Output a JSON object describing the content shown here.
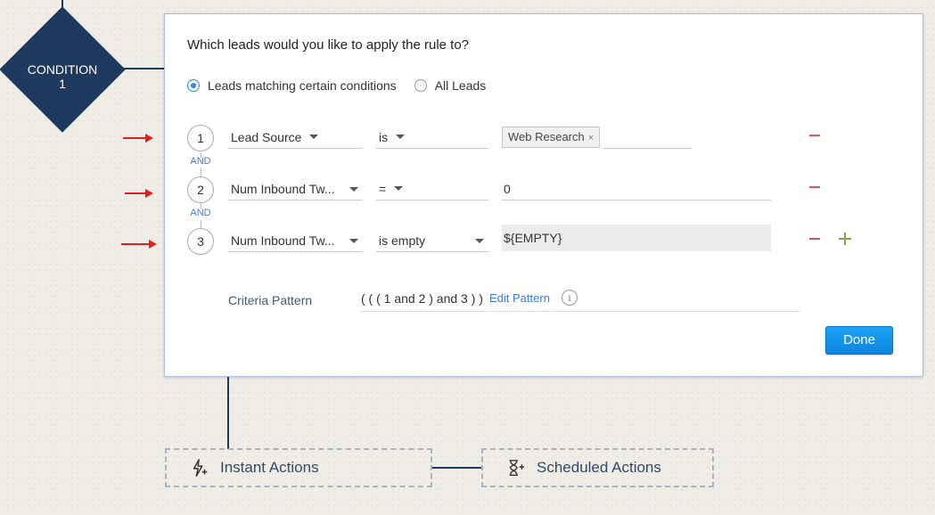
{
  "condition_node": {
    "label_line1": "CONDITION",
    "label_line2": "1"
  },
  "panel": {
    "question": "Which leads would you like to apply the rule to?",
    "radio_options": [
      {
        "label": "Leads matching certain conditions",
        "checked": true
      },
      {
        "label": "All Leads",
        "checked": false
      }
    ],
    "rows": [
      {
        "number": "1",
        "field": "Lead Source",
        "operator": "is",
        "value_chip": "Web Research",
        "value": ""
      },
      {
        "number": "2",
        "field": "Num Inbound Tw...",
        "operator": "=",
        "value": "0"
      },
      {
        "number": "3",
        "field": "Num Inbound Tw...",
        "operator": "is empty",
        "value": "${EMPTY}"
      }
    ],
    "connector_label": "AND",
    "criteria": {
      "label": "Criteria Pattern",
      "pattern": "( ( ( 1 and 2 ) and 3 ) )",
      "edit_link": "Edit Pattern",
      "info_glyph": "i"
    },
    "done_label": "Done"
  },
  "actions": {
    "instant": "Instant Actions",
    "scheduled": "Scheduled Actions"
  },
  "colors": {
    "node": "#1e3a5f",
    "primary_button": "#0b84de",
    "annotation_arrow": "#e01f1f",
    "remove_icon": "#e05555",
    "add_icon": "#8aa04a",
    "link": "#3b7dd8"
  }
}
